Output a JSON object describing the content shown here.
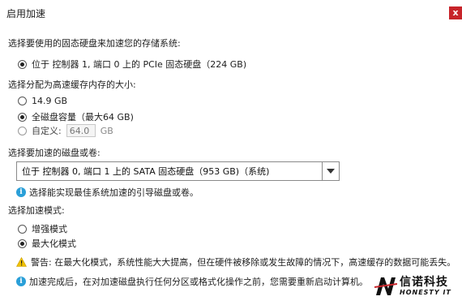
{
  "window": {
    "title": "启用加速",
    "close_glyph": "x"
  },
  "storage_section": {
    "label": "选择要使用的固态硬盘来加速您的存储系统:",
    "option": "位于 控制器 1, 端口 0 上的 PCIe 固态硬盘（224 GB)"
  },
  "cache_size_section": {
    "label": "选择分配为高速缓存内存的大小:",
    "options": [
      "14.9 GB",
      "全磁盘容量（最大64 GB)",
      "自定义:"
    ],
    "selected_index": 1,
    "custom_value": "64.0",
    "custom_unit": "GB"
  },
  "disk_section": {
    "label": "选择要加速的磁盘或卷:",
    "select_value": "位于 控制器 0, 端口 1 上的 SATA 固态硬盘（953 GB)（系统)",
    "hint": "选择能实现最佳系统加速的引导磁盘或卷。"
  },
  "mode_section": {
    "label": "选择加速模式:",
    "options": [
      "增强模式",
      "最大化模式"
    ],
    "selected_index": 1,
    "warning": "警告: 在最大化模式，系统性能大大提高，但在硬件被移除或发生故障的情况下，高速缓存的数据可能丢失。"
  },
  "footer": {
    "note": "加速完成后，在对加速磁盘执行任何分区或格式化操作之前，您需要重新启动计算机。"
  },
  "watermark": {
    "main": "信诺科技",
    "sub": "HONESTY IT"
  },
  "colors": {
    "close": "#c7242a",
    "info": "#2a9fd8",
    "warning": "#f2c200"
  }
}
